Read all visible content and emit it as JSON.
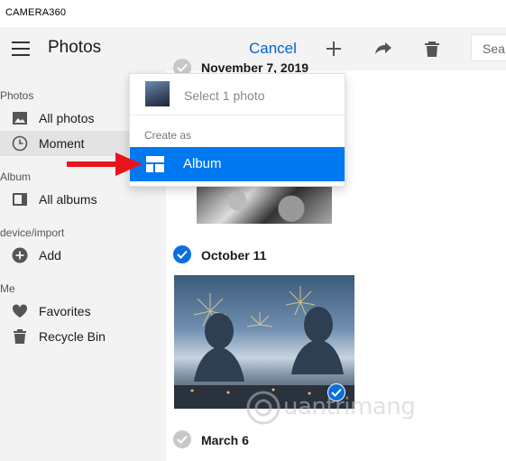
{
  "window": {
    "title": "CAMERA360"
  },
  "header": {
    "title": "Photos",
    "cancel_label": "Cancel",
    "search_placeholder": "Sea"
  },
  "sidebar": {
    "sections": [
      {
        "label": "Photos"
      },
      {
        "label": "Album"
      },
      {
        "label": "device/import"
      },
      {
        "label": "Me"
      }
    ],
    "items": [
      {
        "label": "All photos",
        "icon": "image-icon"
      },
      {
        "label": "Moment",
        "icon": "clock-icon",
        "selected": true
      },
      {
        "label": "All albums",
        "icon": "album-icon"
      },
      {
        "label": "Add",
        "icon": "plus-circle-icon"
      },
      {
        "label": "Favorites",
        "icon": "heart-icon"
      },
      {
        "label": "Recycle Bin",
        "icon": "trash-icon"
      }
    ]
  },
  "content": {
    "groups": [
      {
        "date": "November 7, 2019",
        "checked": false
      },
      {
        "date": "October 11",
        "checked": true
      },
      {
        "date": "March 6",
        "checked": false
      }
    ]
  },
  "flyout": {
    "select_label": "Select 1 photo",
    "create_as_label": "Create as",
    "album_label": "Album"
  },
  "watermark": {
    "text": "uantrimang"
  },
  "colors": {
    "accent": "#0078f0",
    "link": "#0063d1",
    "check": "#0a6fe0",
    "annotation": "#e8141c"
  }
}
